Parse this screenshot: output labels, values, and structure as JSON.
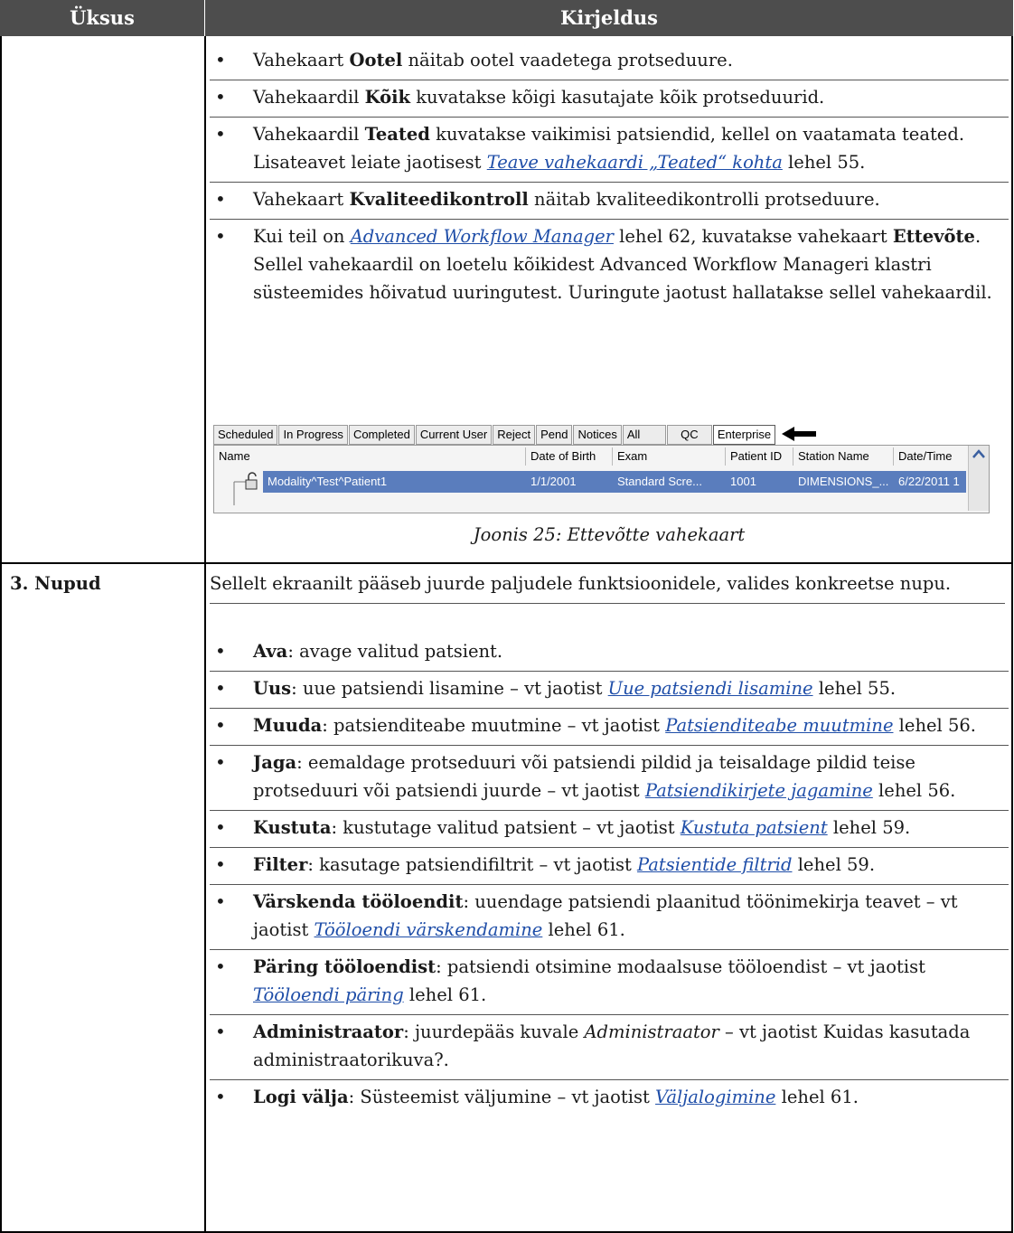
{
  "table": {
    "col_item": "Üksus",
    "col_desc": "Kirjeldus"
  },
  "section1": {
    "bullets": [
      {
        "pre": "Vahekaart ",
        "bold": "Ootel",
        "post": " näitab ootel vaadetega protseduure."
      },
      {
        "pre": "Vahekaardil ",
        "bold": "Kõik",
        "post": " kuvatakse kõigi kasutajate kõik protseduurid."
      },
      {
        "pre": "Vahekaardil ",
        "bold": "Teated",
        "post": " kuvatakse vaikimisi patsiendid, kellel on vaatamata teated. Lisateavet leiate jaotisest ",
        "link": "Teave vahekaardi „Teated“ kohta",
        "tail": " lehel 55."
      },
      {
        "pre": "Vahekaart ",
        "bold": "Kvaliteedikontroll",
        "post": " näitab kvaliteedikontrolli protseduure."
      },
      {
        "pre": "Kui teil on ",
        "link": "Advanced Workflow Manager",
        "mid": " lehel 62, kuvatakse vahekaart ",
        "bold": "Ettevõte",
        "post": ". Sellel vahekaardil on loetelu kõikidest Advanced Workflow Manageri klastri süsteemides hõivatud uuringutest. Uuringute jaotust hallatakse sellel vahekaardil."
      }
    ],
    "figure": {
      "tabs": [
        "Scheduled",
        "In Progress",
        "Completed",
        "Current User",
        "Reject",
        "Pend",
        "Notices",
        "All",
        "QC",
        "Enterprise"
      ],
      "active_tab": "Enterprise",
      "columns": [
        "Name",
        "Date of Birth",
        "Exam",
        "Patient ID",
        "Station Name",
        "Date/Time"
      ],
      "row": [
        "Modality^Test^Patient1",
        "1/1/2001",
        "Standard Scre...",
        "1001",
        "DIMENSIONS_...",
        "6/22/2011 1"
      ],
      "caption": "Joonis 25: Ettevõtte vahekaart"
    }
  },
  "section3": {
    "label": "3. Nupud",
    "intro": "Sellelt ekraanilt pääseb juurde paljudele funktsioonidele, valides konkreetse nupu.",
    "bullets": [
      {
        "bold": "Ava",
        "post": ": avage valitud patsient."
      },
      {
        "bold": "Uus",
        "post": ": uue patsiendi lisamine – vt jaotist ",
        "link": "Uue patsiendi lisamine",
        "tail": " lehel 55."
      },
      {
        "bold": "Muuda",
        "post": ": patsienditeabe muutmine – vt jaotist ",
        "link": "Patsienditeabe muutmine",
        "tail": " lehel 56."
      },
      {
        "bold": "Jaga",
        "post": ": eemaldage protseduuri või patsiendi pildid ja teisaldage pildid teise protseduuri või patsiendi juurde – vt jaotist ",
        "link": "Patsiendikirjete jagamine",
        "tail": " lehel 56."
      },
      {
        "bold": "Kustuta",
        "post": ": kustutage valitud patsient – vt jaotist ",
        "link": "Kustuta patsient",
        "tail": " lehel 59."
      },
      {
        "bold": "Filter",
        "post": ": kasutage patsiendifiltrit – vt jaotist ",
        "link": "Patsientide filtrid",
        "tail": " lehel 59."
      },
      {
        "bold": "Värskenda tööloendit",
        "post": ": uuendage patsiendi plaanitud töönimekirja teavet – vt jaotist ",
        "link": "Tööloendi värskendamine",
        "tail": " lehel 61."
      },
      {
        "bold": "Päring tööloendist",
        "post": ": patsiendi otsimine modaalsuse tööloendist – vt jaotist ",
        "link": "Tööloendi päring",
        "tail": " lehel 61."
      },
      {
        "bold": "Administraator",
        "post": ": juurdepääs kuvale ",
        "ital": "Administraator",
        "tail": " – vt jaotist Kuidas kasutada administraatorikuva?."
      },
      {
        "bold": "Logi välja",
        "post": ": Süsteemist väljumine – vt jaotist ",
        "link": "Väljalogimine",
        "tail": " lehel 61."
      }
    ]
  },
  "colors": {
    "header_bg": "#4d4d4d",
    "link": "#1f4ea8",
    "selection": "#5a7dbd"
  }
}
